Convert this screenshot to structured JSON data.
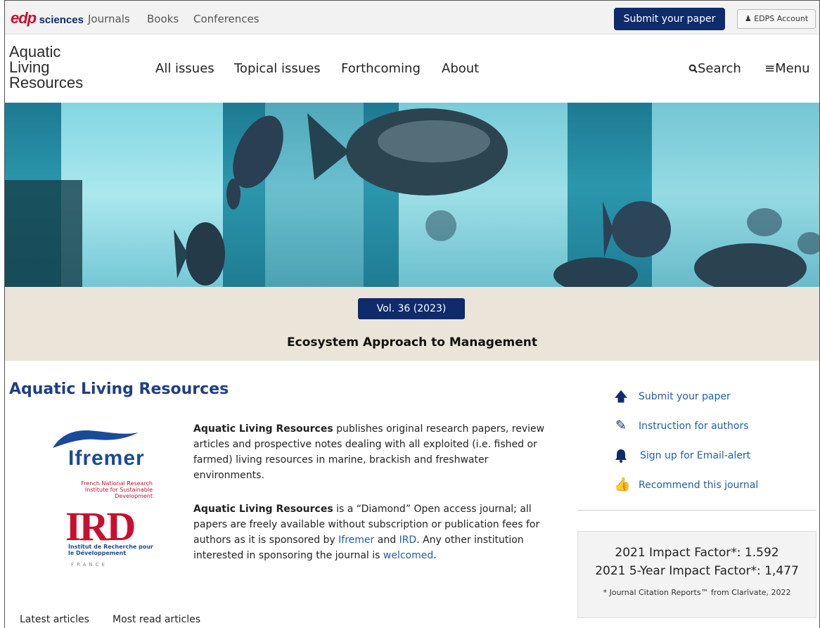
{
  "topbar": {
    "logo_edp": "edp",
    "logo_sciences": "sciences",
    "links": [
      "Journals",
      "Books",
      "Conferences"
    ],
    "submit_label": "Submit your paper",
    "account_label": "EDPS Account"
  },
  "header": {
    "logo_lines": [
      "Aquatic",
      "Living",
      "Resources"
    ],
    "nav": [
      "All issues",
      "Topical issues",
      "Forthcoming",
      "About"
    ],
    "search_label": "Search",
    "menu_label": "Menu"
  },
  "banner": {
    "volume": "Vol. 36 (2023)",
    "title": "Ecosystem Approach to Management"
  },
  "main": {
    "title": "Aquatic Living Resources",
    "ifremer_logo": "Ifremer",
    "ird_caption": "French National Research Institute for Sustainable Development",
    "ird_logo": "IRD",
    "ird_caption2": "Institut de Recherche pour le Développement",
    "ird_france": "FRANCE",
    "p1_bold": "Aquatic Living Resources",
    "p1_rest": " publishes original research papers, review articles and prospective notes dealing with all exploited (i.e. fished or farmed) living resources in marine, brackish and freshwater environments.",
    "p2_bold": "Aquatic Living Resources",
    "p2_a": " is a “Diamond” Open access journal; all papers are freely available without subscription or publication fees for authors as it is sponsored by ",
    "p2_link1": "Ifremer",
    "p2_and": " and ",
    "p2_link2": "IRD",
    "p2_b": ". Any other institution interested in sponsoring the journal is ",
    "p2_link3": "welcomed",
    "p2_end": "."
  },
  "sidebar": {
    "links": [
      "Submit your paper",
      "Instruction for authors",
      "Sign up for Email-alert",
      "Recommend this journal"
    ],
    "impact1": "2021 Impact Factor*: 1.592",
    "impact2": "2021 5-Year Impact Factor*: 1,477",
    "note": "* Journal Citation Reports™ from Clarivate, 2022"
  },
  "tabs": [
    "Latest articles",
    "Most read articles"
  ],
  "colors": {
    "navy": "#0f2b6b",
    "title_blue": "#1f3f82",
    "link_blue": "#1f5fa8",
    "banner_bg": "#ebe4d9"
  }
}
